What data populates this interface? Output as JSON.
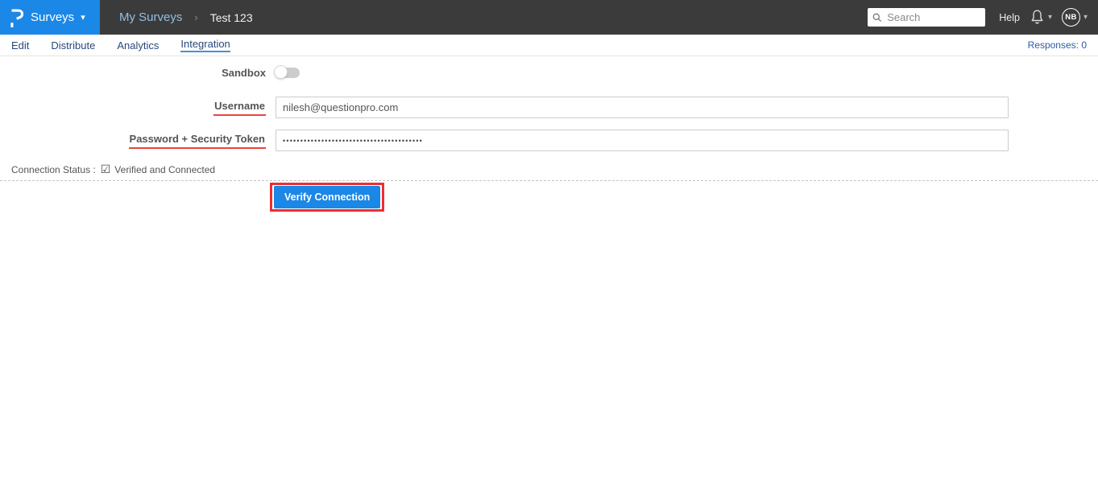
{
  "navbar": {
    "product_label": "Surveys",
    "breadcrumb_parent": "My Surveys",
    "breadcrumb_current": "Test 123",
    "search_placeholder": "Search",
    "help_label": "Help",
    "avatar_initials": "NB"
  },
  "tabs": {
    "items": [
      "Edit",
      "Distribute",
      "Analytics",
      "Integration"
    ],
    "active": "Integration",
    "responses_label": "Responses: 0"
  },
  "form": {
    "sandbox": {
      "label": "Sandbox",
      "state": "off"
    },
    "username": {
      "label": "Username",
      "value": "nilesh@questionpro.com"
    },
    "password": {
      "label": "Password + Security Token",
      "masked_value": "••••••••••••••••••••••••••••••••••••••••"
    },
    "connection_status": {
      "label": "Connection Status :",
      "value": "Verified and Connected"
    },
    "verify_button_label": "Verify Connection"
  },
  "icons": {
    "caret_down": "▾",
    "breadcrumb_chevron": "›",
    "checked_checkbox": "☑"
  },
  "colors": {
    "brand_blue": "#1b87e6",
    "topbar_dark": "#3b3b3b",
    "tab_text_navy": "#29497b",
    "active_tab_underline": "#4a90d9",
    "label_underline_red": "#e8453c",
    "annotation_red": "#ee2e31"
  }
}
